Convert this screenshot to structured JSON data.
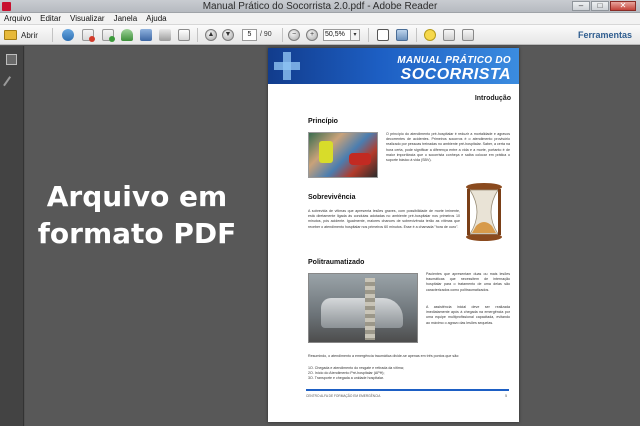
{
  "window": {
    "title": "Manual Prático do Socorrista 2.0.pdf - Adobe Reader",
    "minimize_label": "–",
    "maximize_label": "□",
    "close_label": "✕"
  },
  "menu": [
    "Arquivo",
    "Editar",
    "Visualizar",
    "Janela",
    "Ajuda"
  ],
  "toolbar": {
    "open_label": "Abrir",
    "current_page": "5",
    "total_pages": "/ 90",
    "zoom": "50,5%",
    "zoom_dropdown": "▾",
    "prev_page": "▲",
    "next_page": "▼",
    "zoom_out": "−",
    "zoom_in": "+",
    "tools_label": "Ferramentas"
  },
  "overlay": {
    "line1": "Arquivo em",
    "line2": "formato PDF"
  },
  "document_page": {
    "header_title_1": "MANUAL PRÁTICO DO",
    "header_title_2": "SOCORRISTA",
    "section_title": "Introdução",
    "sections": [
      {
        "heading": "Princípio",
        "text": "O princípio do atendimento pré-hospitalar é reduzir a mortalidade e agravos decorrentes de acidentes. Primeiros socorros é o atendimento provisório realizado por pessoas treinadas no ambiente pré-hospitalar. Saber, a certa na hora certa, pode significar a diferença entre a vida e a morte, portanto é de maior importância que o socorrista conheça e saiba colocar em prática o suporte básico à vida (SBV)."
      },
      {
        "heading": "Sobrevivência",
        "text": "A sobrevida de vítimas que apresenta lesões graves, com possibilidade de morte iminente, está diretamente ligada às condutas adotadas no ambiente pré-hospitalar nos primeiros 10 minutos, pós acidente. Igualmente, maiores chances de sobrevivência terão as vítimas que receber o atendimento hospitalar nos primeiros 60 minutos. Esse é a chamada \"hora de ouro\"."
      },
      {
        "heading": "Politraumatizado",
        "text_right_1": "Pacientes que apresentam duas ou mais lesões traumáticas que necessitem de internação hospitalar para o tratamento de uma delas são caracterizados como politraumatizados.",
        "text_right_2": "A assistência inicial deve ser realizada imediatamente após à chegada na emergência por uma equipe multiprofissional capacitada, evitando ao máximo o agravo das lesões sequelas.",
        "summary": "Resumindo, o atendimento a emergência traumática divide-se apenas em três pontos que são:",
        "list": [
          "1O. Chegada e atendimento do resgate e retirada da vítima;",
          "2O. Início do Atendimento Pré-hospitalar (APH);",
          "3O. Transporte e chegada a unidade hospitalar."
        ]
      }
    ],
    "footer_left": "CENTRO ALFA DE FORMAÇÃO EM EMERGÊNCIA",
    "footer_page": "5"
  }
}
